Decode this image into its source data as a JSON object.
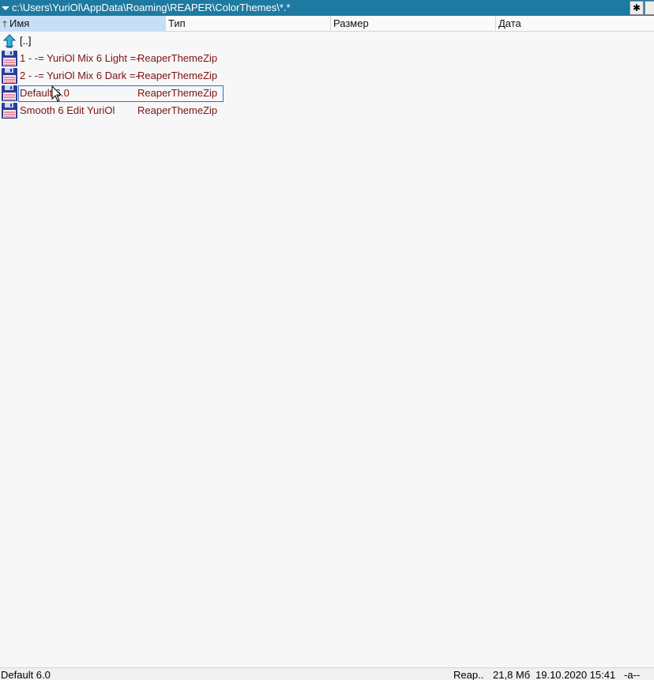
{
  "path_bar": {
    "path": "c:\\Users\\YuriOl\\AppData\\Roaming\\REAPER\\ColorThemes\\*.*",
    "star_button": "✱"
  },
  "columns": {
    "name": "Имя",
    "type": "Тип",
    "size": "Размер",
    "date": "Дата"
  },
  "rows": [
    {
      "name": "[..]",
      "type": "",
      "icon": "folder-up-icon"
    },
    {
      "name": "1 - -= YuriOl Mix 6 Light =-",
      "type": "ReaperThemeZip",
      "icon": "floppy-icon"
    },
    {
      "name": "2 - -= YuriOl Mix 6 Dark =-",
      "type": "ReaperThemeZip",
      "icon": "floppy-icon"
    },
    {
      "name": "Default 6.0",
      "type": "ReaperThemeZip",
      "icon": "floppy-icon",
      "selected": true
    },
    {
      "name": "Smooth 6 Edit YuriOl",
      "type": "ReaperThemeZip",
      "icon": "floppy-icon"
    }
  ],
  "status": {
    "name": "Default  6.0",
    "type": "Reap..",
    "size": "21,8 Мб",
    "date": "19.10.2020 15:41",
    "attr": "-a--"
  },
  "colors": {
    "path_bar_bg": "#1e7aa0",
    "file_text": "#7d1212",
    "header_active_bg": "#c6dff5",
    "selection_border": "#2b6fd6"
  }
}
